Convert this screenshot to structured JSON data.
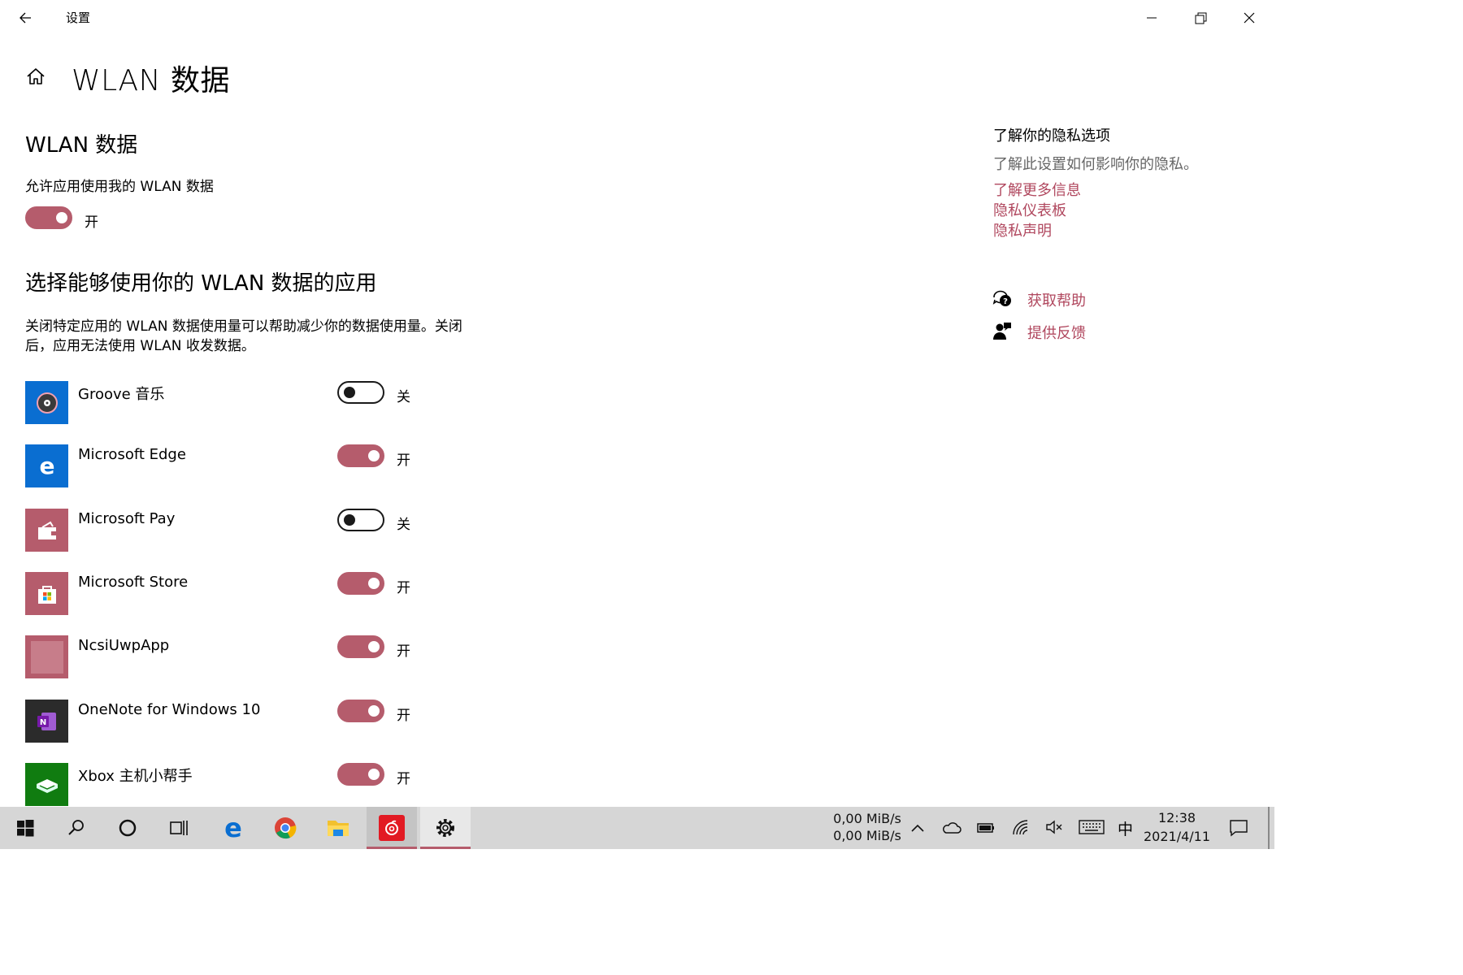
{
  "window": {
    "title": "设置"
  },
  "header": {
    "page_title": "WLAN 数据"
  },
  "section1": {
    "heading": "WLAN 数据",
    "allow_label": "允许应用使用我的 WLAN 数据",
    "allow_state": "开",
    "allow_on": true
  },
  "section2": {
    "heading": "选择能够使用你的 WLAN 数据的应用",
    "desc_line1": "关闭特定应用的 WLAN 数据使用量可以帮助减少你的数据使用量。关闭",
    "desc_line2": "后，应用无法使用 WLAN 收发数据。"
  },
  "apps": [
    {
      "name": "Groove 音乐",
      "state": "关",
      "on": false,
      "icon": "groove-music-icon",
      "color": "#0a6ed1"
    },
    {
      "name": "Microsoft Edge",
      "state": "开",
      "on": true,
      "icon": "edge-icon",
      "color": "#0a6ed1"
    },
    {
      "name": "Microsoft Pay",
      "state": "关",
      "on": false,
      "icon": "wallet-icon",
      "color": "#b55c6c"
    },
    {
      "name": "Microsoft Store",
      "state": "开",
      "on": true,
      "icon": "store-bag-icon",
      "color": "#b55c6c"
    },
    {
      "name": "NcsiUwpApp",
      "state": "开",
      "on": true,
      "icon": "placeholder-app-icon",
      "color": "#b55c6c"
    },
    {
      "name": "OneNote for Windows 10",
      "state": "开",
      "on": true,
      "icon": "onenote-icon",
      "color": "#2b2b2b"
    },
    {
      "name": "Xbox 主机小帮手",
      "state": "开",
      "on": true,
      "icon": "xbox-companion-icon",
      "color": "#107c10"
    }
  ],
  "sidebar": {
    "privacy_heading": "了解你的隐私选项",
    "privacy_desc": "了解此设置如何影响你的隐私。",
    "links": [
      "了解更多信息",
      "隐私仪表板",
      "隐私声明"
    ],
    "get_help": "获取帮助",
    "feedback": "提供反馈"
  },
  "taskbar": {
    "net_up": "0,00 MiB/s",
    "net_down": "0,00 MiB/s",
    "ime": "中",
    "time": "12:38",
    "date": "2021/4/11"
  },
  "colors": {
    "accent": "#b55c6c",
    "link": "#b0475e",
    "taskbar": "#d6d6d6"
  }
}
